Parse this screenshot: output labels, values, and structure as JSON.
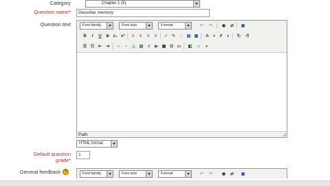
{
  "category": {
    "label": "Category",
    "value": "Chapter 1 (5)"
  },
  "question_name": {
    "label": "Question name",
    "required_mark": "*",
    "value": "Describe memory"
  },
  "question_text": {
    "label": "Question text",
    "toolbar": {
      "font_family": "Font family",
      "font_size": "Font size",
      "format": "Format",
      "row1_icons": [
        "undo-icon",
        "redo-icon",
        "find-icon",
        "replace-icon",
        "fullscreen-icon"
      ],
      "row2_icons": [
        "bold-icon",
        "italic-icon",
        "underline-icon",
        "strikethrough-icon",
        "subscript-icon",
        "superscript-icon",
        "align-left-icon",
        "align-center-icon",
        "align-right-icon",
        "spellcheck-icon",
        "clean-icon",
        "cleanup-icon",
        "paste-word-icon",
        "text-color-icon",
        "background-color-icon",
        "ltr-icon",
        "rtl-icon"
      ],
      "row3_icons": [
        "bullet-list-icon",
        "numbered-list-icon",
        "outdent-icon",
        "indent-icon",
        "link-icon",
        "unlink-icon",
        "anchor-icon",
        "image-icon",
        "media-icon",
        "equation-icon",
        "table-icon",
        "special-char-icon",
        "nonbreaking-icon",
        "html-icon",
        "emoticon-icon"
      ]
    },
    "path_label": "Path",
    "format_select": "HTML format"
  },
  "default_grade": {
    "label_line1": "Default question",
    "label_line2": "grade",
    "required_mark": "*",
    "value": "1"
  },
  "general_feedback": {
    "label": "General feedback",
    "toolbar": {
      "font_family": "Font family",
      "font_size": "Font size",
      "format": "Format"
    }
  },
  "colors": {
    "label_red": "#b03030",
    "required": "#cc0000",
    "help_yellow": "#f2c200"
  }
}
